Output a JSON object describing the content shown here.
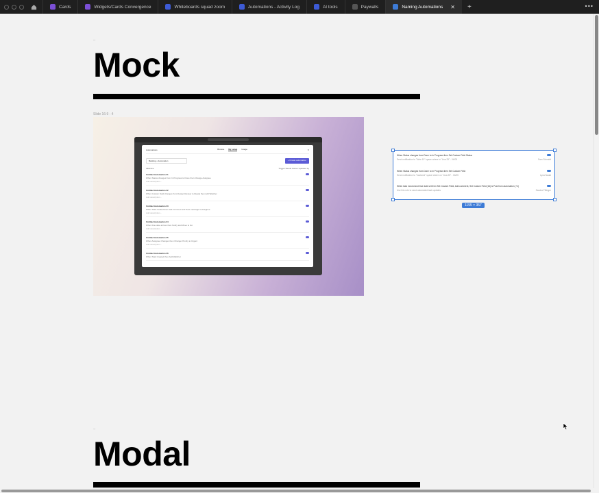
{
  "tabs": [
    {
      "label": "Cards",
      "color": "#7b4fd6",
      "active": false
    },
    {
      "label": "Widgets/Cards Convergence",
      "color": "#7b4fd6",
      "active": false
    },
    {
      "label": "Whiteboards squad zoom",
      "color": "#3d5bd6",
      "active": false
    },
    {
      "label": "Automations - Activity Log",
      "color": "#3d5bd6",
      "active": false
    },
    {
      "label": "AI tools",
      "color": "#3d5bd6",
      "active": false
    },
    {
      "label": "Paywalls",
      "color": "#555555",
      "active": false
    },
    {
      "label": "Naming Automations",
      "color": "#3d7bd6",
      "active": true
    }
  ],
  "sections": [
    {
      "dash": "--",
      "title": "Mock"
    },
    {
      "dash": "--",
      "title": "Modal"
    }
  ],
  "slide_label": "Slide 16:9 - 4",
  "mock": {
    "window_title": "Automations",
    "tabs": [
      "Browse",
      "My setup",
      "Usage"
    ],
    "space_select": "Backlog • Automation",
    "new_button": "+ Create automation",
    "filters": [
      "All",
      "Active",
      "Trigger",
      "Result",
      "Owner",
      "Updated by"
    ],
    "items": [
      {
        "title": "Untitled Automation #1",
        "rule": "When  Status changes  from  In Progress  to  Done  then  Change Assignee",
        "sub": "Add description..."
      },
      {
        "title": "Untitled Automation #2",
        "rule": "When  Custom Field changes  from  Design Review  to  Ready  then  Add Watcher",
        "sub": "Add description..."
      },
      {
        "title": "Untitled Automation #3",
        "rule": "When  Task created  then  Add comment  and  Post message  to  Assignee",
        "sub": "Add description..."
      },
      {
        "title": "Untitled Automation #4",
        "rule": "When  Due date arrives  then  Notify  and  Move to list",
        "sub": "Add description..."
      },
      {
        "title": "Untitled Automation #5",
        "rule": "When  Assignee Changes  then  Change Priority  to  Urgent",
        "sub": "Add description..."
      },
      {
        "title": "Untitled Automation #6",
        "rule": "When  Task Created  then  Add Watcher",
        "sub": "Add description..."
      }
    ]
  },
  "selection": {
    "rows": [
      {
        "rule": "When Status changes from Done to In Progress then Set Custom Field Status",
        "sub": "Send notification to \"Note 10\" space where in \"Lisa 25\" - 04/05",
        "owner": "Sam Schmidt"
      },
      {
        "rule": "When Status changes from Done to In Progress then Set Custom Field",
        "sub": "Send notification to \"backend\" space where on \"Lisa 25\" - 04/05",
        "owner": "Lyna Nadal"
      },
      {
        "rule": "When task moved and Due date set then Set Custom Field, Add comment, Set Custom Field (16) & Post from Automation (+1)",
        "sub": "Use this rule to send automated task updates",
        "owner": "Sandra Fillinger"
      }
    ],
    "size_label": "1155 × 357"
  }
}
